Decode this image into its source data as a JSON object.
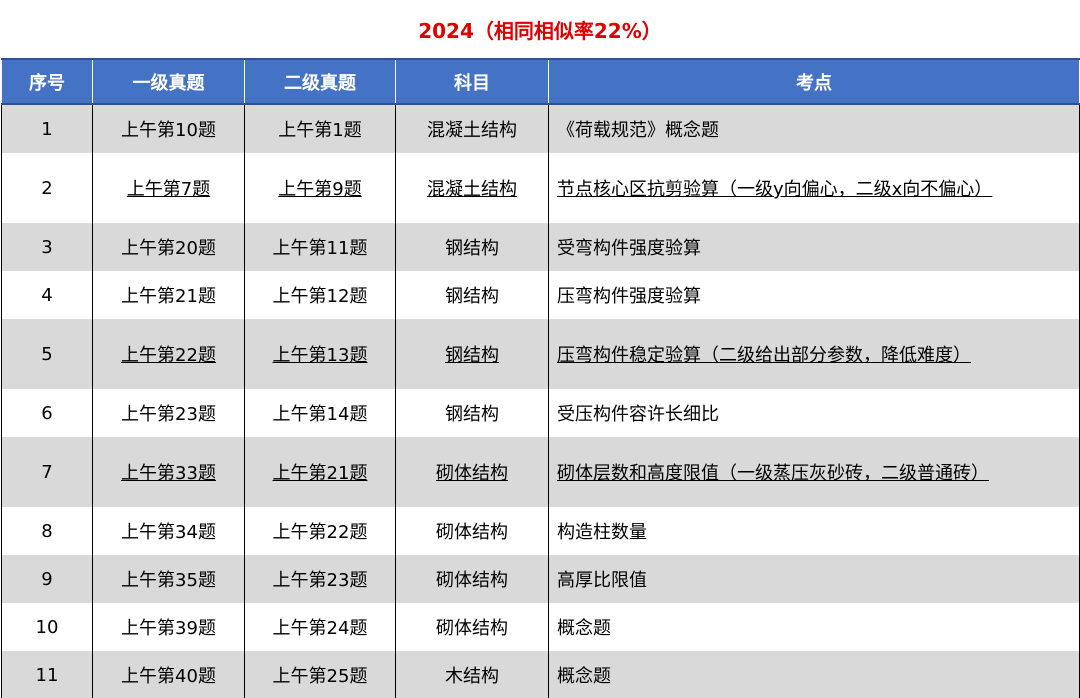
{
  "title": "2024（相同相似率22%）",
  "headers": [
    "序号",
    "一级真题",
    "二级真题",
    "科目",
    "考点"
  ],
  "rows": [
    {
      "no": "1",
      "level1": "上午第10题",
      "level2": "上午第1题",
      "subject": "混凝土结构",
      "point": "《荷载规范》概念题",
      "underline": false
    },
    {
      "no": "2",
      "level1": "上午第7题",
      "level2": "上午第9题",
      "subject": "混凝土结构",
      "point": "节点核心区抗剪验算（一级y向偏心，二级x向不偏心）",
      "underline": true
    },
    {
      "no": "3",
      "level1": "上午第20题",
      "level2": "上午第11题",
      "subject": "钢结构",
      "point": "受弯构件强度验算",
      "underline": false
    },
    {
      "no": "4",
      "level1": "上午第21题",
      "level2": "上午第12题",
      "subject": "钢结构",
      "point": "压弯构件强度验算",
      "underline": false
    },
    {
      "no": "5",
      "level1": "上午第22题",
      "level2": "上午第13题",
      "subject": "钢结构",
      "point": "压弯构件稳定验算（二级给出部分参数，降低难度）",
      "underline": true
    },
    {
      "no": "6",
      "level1": "上午第23题",
      "level2": "上午第14题",
      "subject": "钢结构",
      "point": "受压构件容许长细比",
      "underline": false
    },
    {
      "no": "7",
      "level1": "上午第33题",
      "level2": "上午第21题",
      "subject": "砌体结构",
      "point": "砌体层数和高度限值（一级蒸压灰砂砖，二级普通砖）",
      "underline": true
    },
    {
      "no": "8",
      "level1": "上午第34题",
      "level2": "上午第22题",
      "subject": "砌体结构",
      "point": "构造柱数量",
      "underline": false
    },
    {
      "no": "9",
      "level1": "上午第35题",
      "level2": "上午第23题",
      "subject": "砌体结构",
      "point": "高厚比限值",
      "underline": false
    },
    {
      "no": "10",
      "level1": "上午第39题",
      "level2": "上午第24题",
      "subject": "砌体结构",
      "point": "概念题",
      "underline": false
    },
    {
      "no": "11",
      "level1": "上午第40题",
      "level2": "上午第25题",
      "subject": "木结构",
      "point": "概念题",
      "underline": false
    }
  ]
}
